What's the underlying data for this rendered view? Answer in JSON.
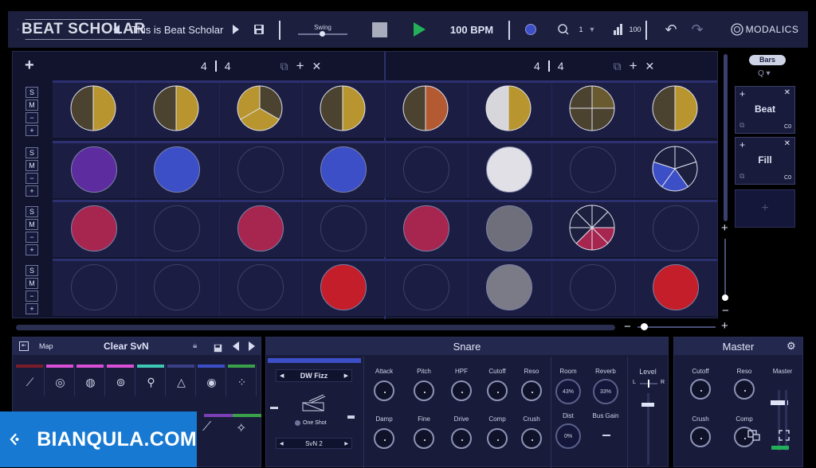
{
  "topbar": {
    "logo": "BEAT SCHOLAR",
    "pattern_title": "This is Beat Scholar",
    "swing_label": "Swing",
    "bpm": "100 BPM",
    "quantize": "1",
    "velocity": "100",
    "brand": "MODALICS"
  },
  "grid": {
    "meters": [
      {
        "top": "4",
        "bottom": "4"
      },
      {
        "top": "4",
        "bottom": "4"
      }
    ],
    "rows": [
      {
        "label": "row-1",
        "pads": [
          {
            "type": "split2",
            "colors": [
              "#b8952e",
              "#4b4230"
            ]
          },
          {
            "type": "split2",
            "colors": [
              "#b8952e",
              "#4b4230"
            ]
          },
          {
            "type": "split3",
            "colors": [
              "#4b4230",
              "#b8952e",
              "#b8952e"
            ]
          },
          {
            "type": "split2",
            "colors": [
              "#b8952e",
              "#4b4230"
            ]
          },
          {
            "type": "split2",
            "colors": [
              "#b35a33",
              "#4b4230"
            ]
          },
          {
            "type": "split2",
            "colors": [
              "#b8952e",
              "#d6d6db"
            ]
          },
          {
            "type": "split4",
            "colors": [
              "#6a5a30",
              "#4b4230",
              "#4b4230",
              "#4b4230"
            ]
          },
          {
            "type": "split2",
            "colors": [
              "#b8952e",
              "#4b4230"
            ]
          }
        ]
      },
      {
        "label": "row-2",
        "pads": [
          {
            "type": "solid",
            "colors": [
              "#5d2c9f"
            ]
          },
          {
            "type": "solid",
            "colors": [
              "#3c4fc7"
            ]
          },
          {
            "type": "empty"
          },
          {
            "type": "solid",
            "colors": [
              "#3c4fc7"
            ]
          },
          {
            "type": "empty"
          },
          {
            "type": "solid",
            "colors": [
              "#e0e0e6"
            ]
          },
          {
            "type": "empty"
          },
          {
            "type": "split5",
            "colors": [
              "#1c1f3d",
              "#1c1f3d",
              "#3c4fc7",
              "#3c4fc7",
              "#1c1f3d"
            ]
          }
        ]
      },
      {
        "label": "row-3",
        "pads": [
          {
            "type": "solid",
            "colors": [
              "#a72650"
            ]
          },
          {
            "type": "empty"
          },
          {
            "type": "solid",
            "colors": [
              "#a72650"
            ]
          },
          {
            "type": "empty"
          },
          {
            "type": "solid",
            "colors": [
              "#a72650"
            ]
          },
          {
            "type": "solid",
            "colors": [
              "#6e6f7a"
            ]
          },
          {
            "type": "split8",
            "colors": [
              "#1c1f3d",
              "#1c1f3d",
              "#a72650",
              "#a72650",
              "#a72650",
              "#1c1f3d",
              "#1c1f3d",
              "#1c1f3d"
            ]
          },
          {
            "type": "empty"
          }
        ]
      },
      {
        "label": "row-4",
        "pads": [
          {
            "type": "empty"
          },
          {
            "type": "empty"
          },
          {
            "type": "empty"
          },
          {
            "type": "solid",
            "colors": [
              "#c41e2a"
            ]
          },
          {
            "type": "empty"
          },
          {
            "type": "solid",
            "colors": [
              "#7a7b86"
            ]
          },
          {
            "type": "empty"
          },
          {
            "type": "solid",
            "colors": [
              "#c41e2a"
            ]
          }
        ]
      }
    ]
  },
  "right": {
    "bars_label": "Bars",
    "q_label": "Q",
    "beat_label": "Beat",
    "beat_tag": "C0",
    "fill_label": "Fill",
    "fill_tag": "C0"
  },
  "kit": {
    "map_label": "Map",
    "kit_name": "Clear SvN",
    "instruments": [
      {
        "color": "#7a1d2a",
        "icon": "cymbal-icon"
      },
      {
        "color": "#d94fd6",
        "icon": "kick-icon"
      },
      {
        "color": "#d94fd6",
        "icon": "snare-icon"
      },
      {
        "color": "#d94fd6",
        "icon": "tom-icon"
      },
      {
        "color": "#3fc7b5",
        "icon": "shaker-icon"
      },
      {
        "color": "#3a3f86",
        "icon": "triangle-icon"
      },
      {
        "color": "#3c4fc7",
        "icon": "bell-icon"
      },
      {
        "color": "#3aa04a",
        "icon": "dots-icon"
      }
    ]
  },
  "snare": {
    "title": "Snare",
    "sample": "DW Fizz",
    "oneshot": "One Shot",
    "variant": "SvN 2",
    "knobs_top": [
      "Attack",
      "Pitch",
      "HPF",
      "Cutoff",
      "Reso"
    ],
    "knobs_bottom": [
      "Damp",
      "Fine",
      "Drive",
      "Comp",
      "Crush"
    ],
    "room_label": "Room",
    "room_value": "43%",
    "reverb_label": "Reverb",
    "reverb_value": "33%",
    "dist_label": "Dist",
    "dist_value": "0%",
    "busgain_label": "Bus Gain",
    "level_label": "Level",
    "l": "L",
    "r": "R"
  },
  "master": {
    "title": "Master",
    "knobs": [
      "Cutoff",
      "Reso",
      "Crush",
      "Comp"
    ],
    "master_label": "Master"
  },
  "watermark": {
    "text": "BIANQULA.COM"
  }
}
